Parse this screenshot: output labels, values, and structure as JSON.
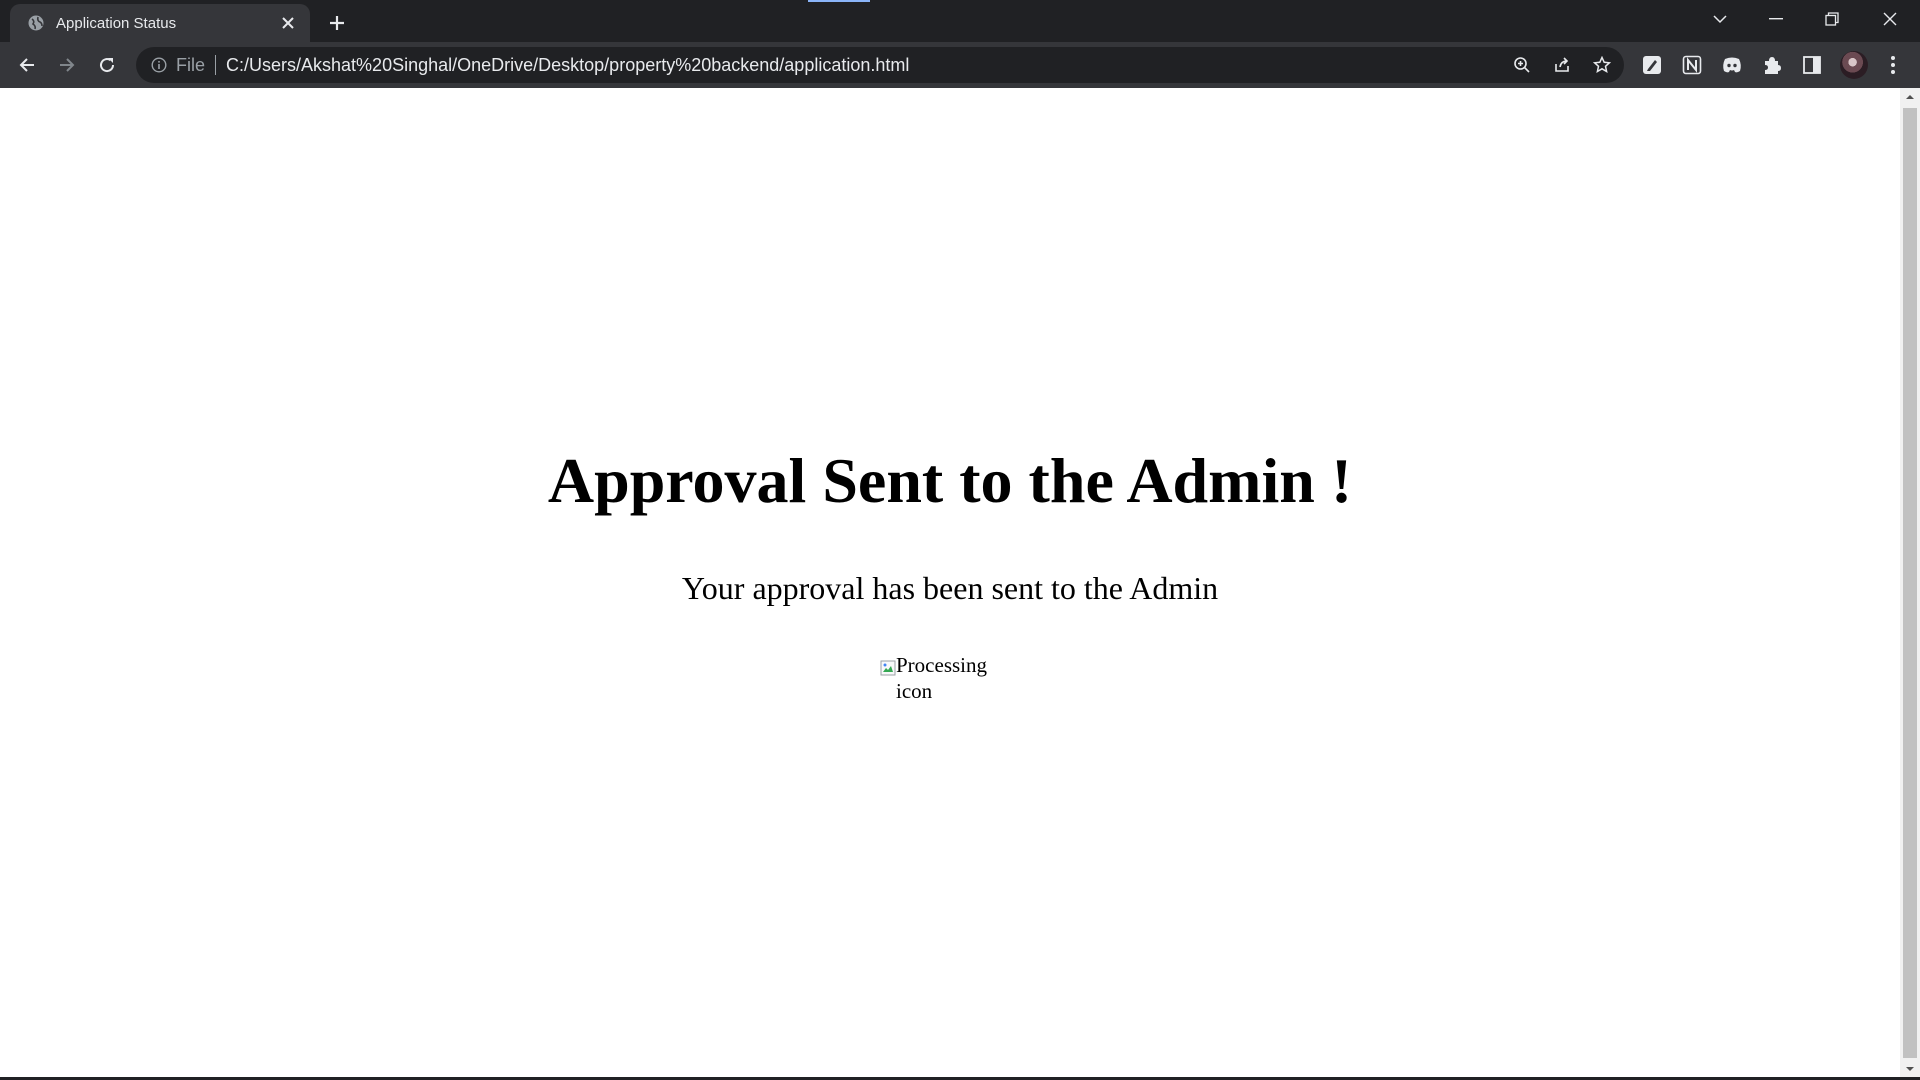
{
  "browser": {
    "tab": {
      "title": "Application Status",
      "favicon": "globe-icon"
    },
    "new_tab_icon": "plus-icon",
    "window_controls": [
      "tab-search-icon",
      "minimize-icon",
      "restore-icon",
      "close-icon"
    ],
    "toolbar": {
      "back_icon": "arrow-left-icon",
      "forward_icon": "arrow-right-icon",
      "reload_icon": "reload-icon",
      "omnibox": {
        "info_icon": "info-icon",
        "scheme_label": "File",
        "url": "C:/Users/Akshat%20Singhal/OneDrive/Desktop/property%20backend/application.html"
      },
      "omnibox_icons": [
        "zoom-icon",
        "share-icon",
        "star-icon"
      ],
      "extensions": [
        "extension-edit-icon",
        "notion-icon",
        "discord-icon",
        "puzzle-icon",
        "side-panel-icon"
      ],
      "menu_icon": "kebab-menu-icon"
    },
    "colors": {
      "frame": "#202124",
      "toolbar": "#35363a",
      "text": "#e8eaed",
      "loading_accent": "#8ab4f8"
    }
  },
  "page": {
    "heading": "Approval Sent to the Admin !",
    "message": "Your approval has been sent to the Admin",
    "image_alt": "Processing icon",
    "background": "#ffffff"
  }
}
